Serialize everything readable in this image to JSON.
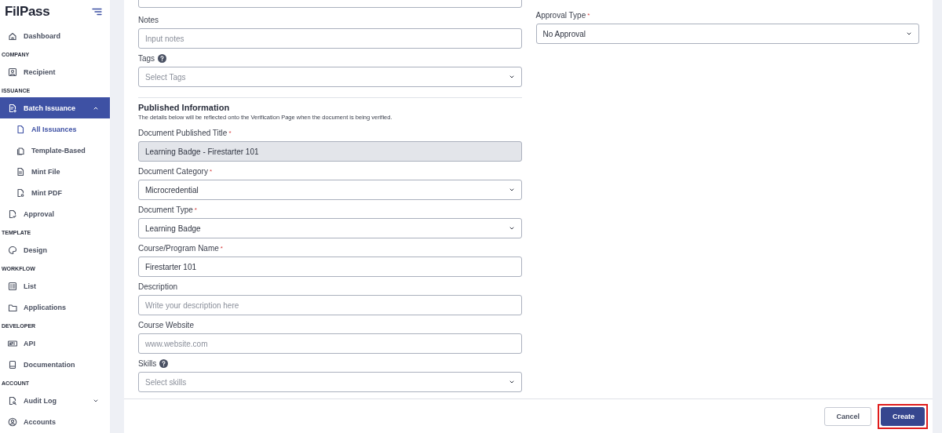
{
  "sidebar": {
    "logo": {
      "text": "FilPass"
    },
    "sections": [
      {
        "items": [
          {
            "label": "Dashboard",
            "selected": false
          }
        ]
      },
      {
        "label": "COMPANY",
        "items": [
          {
            "label": "Recipient",
            "selected": false
          }
        ]
      },
      {
        "label": "ISSUANCE",
        "items": [
          {
            "label": "Batch Issuance",
            "selected": true,
            "expanded": true,
            "children": [
              {
                "label": "All Issuances",
                "selected": true
              },
              {
                "label": "Template-Based",
                "selected": false
              },
              {
                "label": "Mint File",
                "selected": false
              },
              {
                "label": "Mint PDF",
                "selected": false
              }
            ]
          },
          {
            "label": "Approval",
            "selected": false
          }
        ]
      },
      {
        "label": "TEMPLATE",
        "items": [
          {
            "label": "Design",
            "selected": false
          }
        ]
      },
      {
        "label": "WORKFLOW",
        "items": [
          {
            "label": "List",
            "selected": false
          },
          {
            "label": "Applications",
            "selected": false
          }
        ]
      },
      {
        "label": "DEVELOPER",
        "items": [
          {
            "label": "API",
            "selected": false
          },
          {
            "label": "Documentation",
            "selected": false
          }
        ]
      },
      {
        "label": "ACCOUNT",
        "items": [
          {
            "label": "Audit Log",
            "selected": false,
            "expanded": false
          },
          {
            "label": "Accounts",
            "selected": false
          }
        ]
      }
    ]
  },
  "form": {
    "left": [
      {
        "kind": "cut"
      },
      {
        "kind": "input",
        "label": "Notes",
        "placeholder": "Input notes"
      },
      {
        "kind": "select",
        "label": "Tags",
        "help": true,
        "placeholder": "Select Tags"
      },
      {
        "kind": "section",
        "title": "Published Information",
        "description": "The details below will be reflected onto the Verification Page when the document is being verified."
      },
      {
        "kind": "input",
        "label": "Document Published Title",
        "required_mark": "*",
        "value": "Learning Badge - Firestarter 101",
        "disabled": true
      },
      {
        "kind": "select",
        "label": "Document Category",
        "required_mark": "*",
        "value": "Microcredential"
      },
      {
        "kind": "select",
        "label": "Document Type",
        "required_mark": "*",
        "value": "Learning Badge"
      },
      {
        "kind": "input",
        "label": "Course/Program Name",
        "required_mark": "*",
        "value": "Firestarter 101"
      },
      {
        "kind": "input",
        "label": "Description",
        "placeholder": "Write your description here"
      },
      {
        "kind": "input",
        "label": "Course Website",
        "placeholder": "www.website.com"
      },
      {
        "kind": "select",
        "label": "Skills",
        "help": true,
        "placeholder": "Select skills"
      }
    ],
    "right": [
      {
        "kind": "select",
        "label": "Approval Type",
        "required_mark": "*",
        "value": "No Approval"
      }
    ]
  },
  "footer": {
    "buttons": [
      {
        "label": "Cancel",
        "kind": "secondary",
        "highlighted": false
      },
      {
        "label": "Create",
        "kind": "primary",
        "highlighted": true
      }
    ]
  }
}
